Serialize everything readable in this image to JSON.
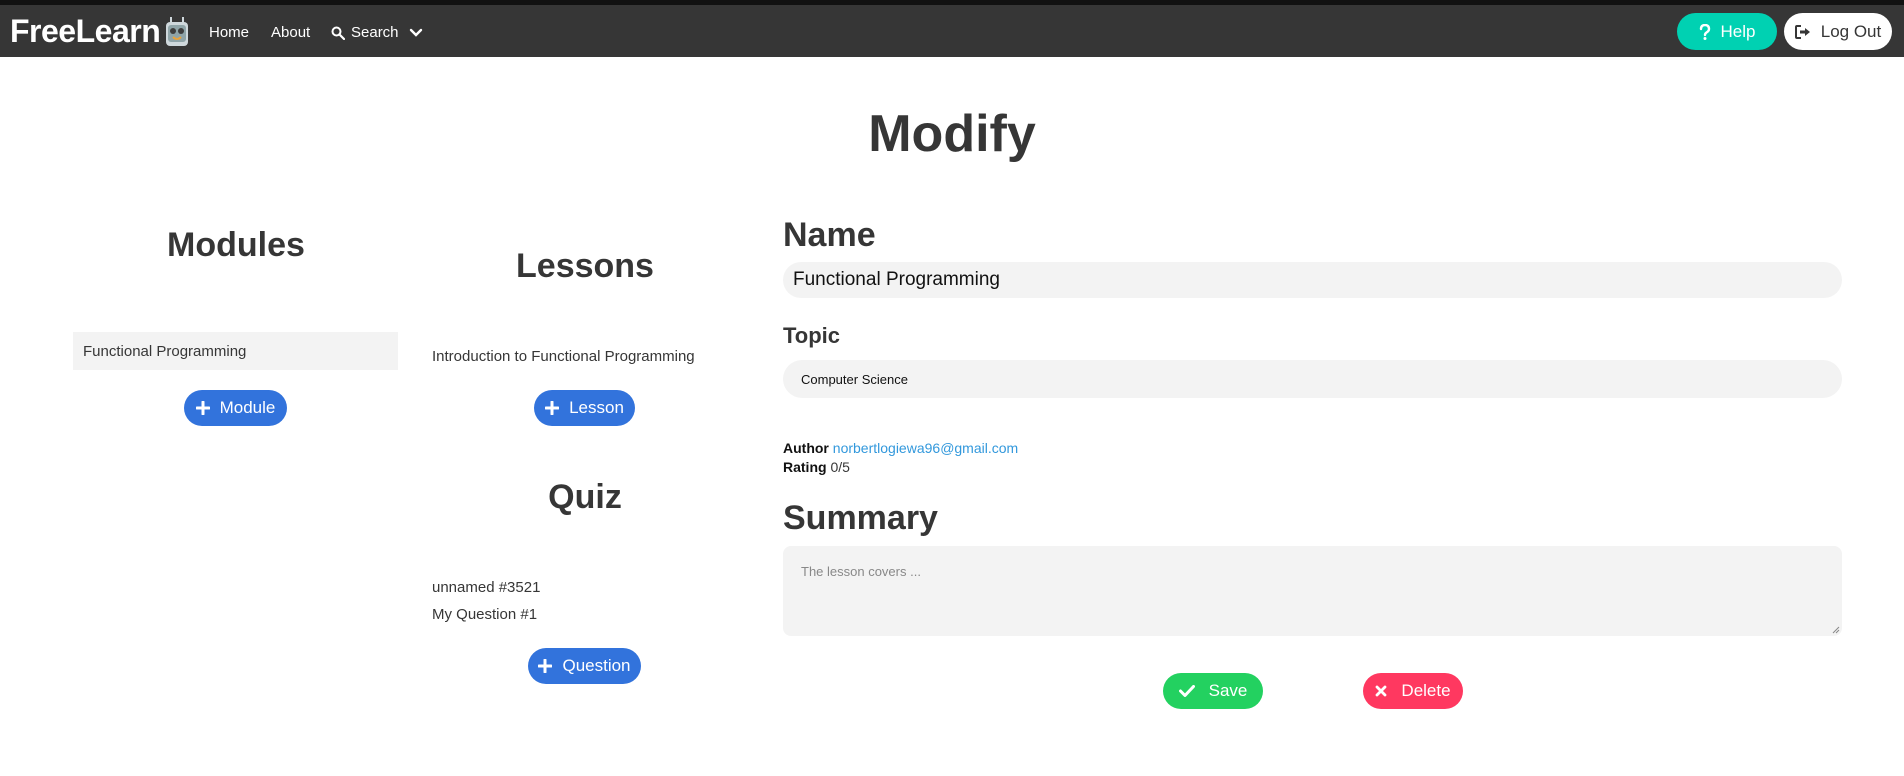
{
  "navbar": {
    "brand": "FreeLearn",
    "home": "Home",
    "about": "About",
    "search": "Search",
    "help": "Help",
    "logout": "Log Out"
  },
  "page": {
    "title": "Modify"
  },
  "modules": {
    "heading": "Modules",
    "items": [
      "Functional Programming"
    ],
    "add_label": "Module"
  },
  "lessons": {
    "heading": "Lessons",
    "items": [
      "Introduction to Functional Programming"
    ],
    "add_label": "Lesson"
  },
  "quiz": {
    "heading": "Quiz",
    "items": [
      "unnamed #3521",
      "My Question #1"
    ],
    "add_label": "Question"
  },
  "form": {
    "name_heading": "Name",
    "name_value": "Functional Programming",
    "topic_heading": "Topic",
    "topic_value": "Computer Science",
    "author_label": "Author",
    "author_value": "norbertlogiewa96@gmail.com",
    "rating_label": "Rating",
    "rating_value": "0/5",
    "summary_heading": "Summary",
    "summary_placeholder": "The lesson covers ...",
    "save_label": "Save",
    "delete_label": "Delete"
  },
  "colors": {
    "navbar": "#363636",
    "help": "#00d1b2",
    "primary": "#3273dc",
    "save": "#23d160",
    "delete": "#ff3860",
    "link": "#3298dc"
  },
  "icons": {
    "search": "search-icon",
    "chevron": "chevron-down-icon",
    "help": "question-icon",
    "logout": "sign-out-icon",
    "plus": "plus-icon",
    "save": "check-icon",
    "delete": "times-icon",
    "robot": "robot-logo-icon"
  }
}
